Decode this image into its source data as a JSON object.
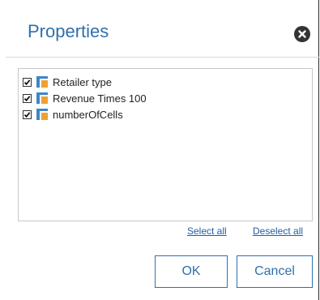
{
  "dialog": {
    "title": "Properties",
    "close_icon": "close-circle-icon"
  },
  "properties": {
    "items": [
      {
        "label": "Retailer type",
        "checked": true,
        "icon": "field-icon"
      },
      {
        "label": "Revenue Times 100",
        "checked": true,
        "icon": "field-icon"
      },
      {
        "label": "numberOfCells",
        "checked": true,
        "icon": "field-icon"
      }
    ]
  },
  "links": {
    "select_all": "Select all",
    "deselect_all": "Deselect all"
  },
  "buttons": {
    "ok": "OK",
    "cancel": "Cancel"
  },
  "colors": {
    "accent": "#2f6fad",
    "link": "#1f5fa8",
    "icon_blue": "#3c86c9",
    "icon_orange": "#f0a030"
  }
}
